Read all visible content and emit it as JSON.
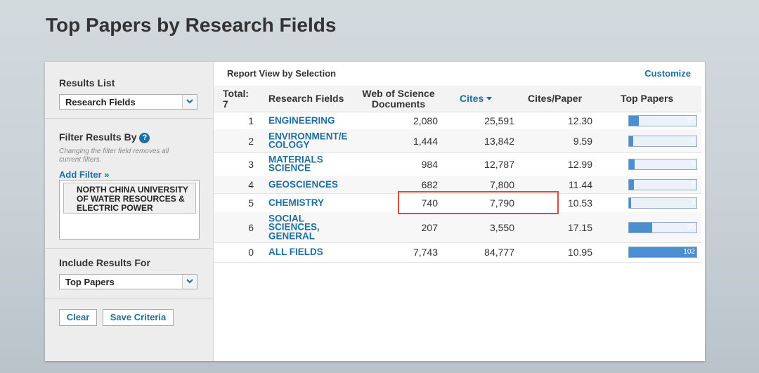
{
  "page_title": "Top Papers by Research Fields",
  "sidebar": {
    "results_list": {
      "label": "Results List",
      "selected": "Research Fields"
    },
    "filter": {
      "label": "Filter Results By",
      "note": "Changing the filter field removes all current filters.",
      "add_filter": "Add Filter »",
      "active_filter": "NORTH CHINA UNIVERSITY OF WATER RESOURCES & ELECTRIC POWER"
    },
    "include": {
      "label": "Include Results For",
      "selected": "Top Papers"
    },
    "buttons": {
      "clear": "Clear",
      "save": "Save Criteria"
    }
  },
  "report": {
    "title": "Report View by Selection",
    "customize": "Customize",
    "columns": {
      "total": "Total: 7",
      "field": "Research Fields",
      "docs": "Web of Science Documents",
      "cites": "Cites",
      "cpp": "Cites/Paper",
      "top": "Top Papers"
    },
    "rows": [
      {
        "rank": "1",
        "field": "ENGINEERING",
        "docs": "2,080",
        "cites": "25,591",
        "cpp": "12.30",
        "top": "15",
        "top_fraction": 0.147
      },
      {
        "rank": "2",
        "field": "ENVIRONMENT/E COLOGY",
        "docs": "1,444",
        "cites": "13,842",
        "cpp": "9.59",
        "top": "6",
        "top_fraction": 0.059
      },
      {
        "rank": "3",
        "field": "MATERIALS SCIENCE",
        "docs": "984",
        "cites": "12,787",
        "cpp": "12.99",
        "top": "9",
        "top_fraction": 0.088
      },
      {
        "rank": "4",
        "field": "GEOSCIENCES",
        "docs": "682",
        "cites": "7,800",
        "cpp": "11.44",
        "top": "8",
        "top_fraction": 0.078
      },
      {
        "rank": "5",
        "field": "CHEMISTRY",
        "docs": "740",
        "cites": "7,790",
        "cpp": "10.53",
        "top": "3",
        "top_fraction": 0.029
      },
      {
        "rank": "6",
        "field": "SOCIAL SCIENCES, GENERAL",
        "docs": "207",
        "cites": "3,550",
        "cpp": "17.15",
        "top": "35",
        "top_fraction": 0.343
      },
      {
        "rank": "0",
        "field": "ALL FIELDS",
        "docs": "7,743",
        "cites": "84,777",
        "cpp": "10.95",
        "top": "102",
        "top_fraction": 1.0
      }
    ]
  },
  "colors": {
    "link": "#1f6fa3",
    "bar": "#4a8fd1",
    "highlight": "#e04a3a"
  },
  "icons": {
    "select_arrow": "chevron-down-icon",
    "help": "question-icon",
    "sort": "sort-down-icon"
  }
}
